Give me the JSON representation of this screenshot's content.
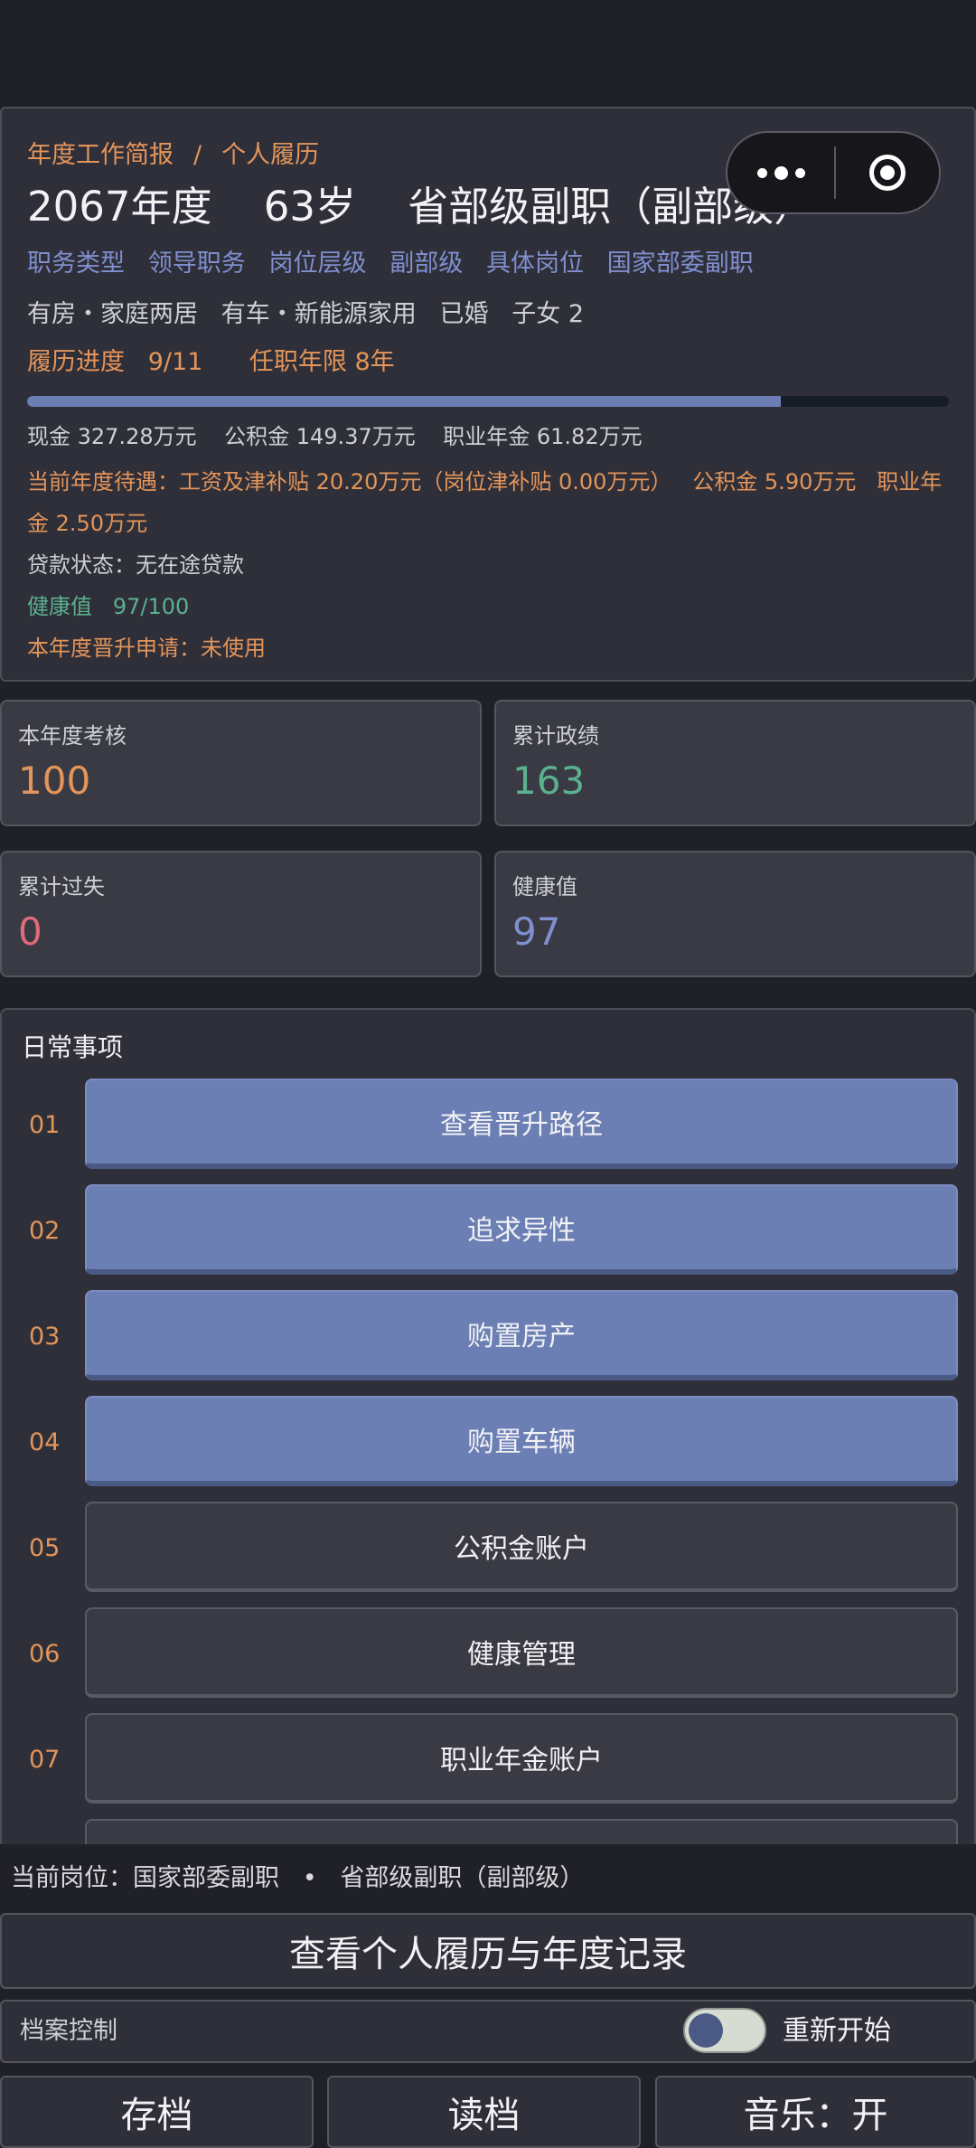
{
  "breadcrumb": {
    "left": "年度工作简报",
    "sep": "/",
    "right": "个人履历"
  },
  "headline": {
    "year": "2067年度",
    "age": "63岁",
    "rank": "省部级副职（副部级）"
  },
  "tags": {
    "type_label": "职务类型",
    "type_value": "领导职务",
    "level_label": "岗位层级",
    "level_value": "副部级",
    "post_label": "具体岗位",
    "post_value": "国家部委副职"
  },
  "assets": {
    "house": "有房・家庭两居",
    "car": "有车・新能源家用",
    "married": "已婚",
    "children": "子女 2"
  },
  "progress": {
    "label": "履历进度",
    "value": "9/11",
    "fraction": 0.8181,
    "tenure": "任职年限 8年"
  },
  "money": {
    "cash": "现金 327.28万元",
    "fund": "公积金 149.37万元",
    "pension": "职业年金 61.82万元"
  },
  "current_pay": "当前年度待遇：工资及津补贴 20.20万元（岗位津补贴 0.00万元）   公积金 5.90万元   职业年金 2.50万元",
  "loan": "贷款状态：无在途贷款",
  "health_line": {
    "label": "健康值",
    "value": "97/100"
  },
  "promotion": "本年度晋升申请：未使用",
  "stats": [
    {
      "label": "本年度考核",
      "value": "100",
      "color": "#e3955a"
    },
    {
      "label": "累计政绩",
      "value": "163",
      "color": "#5bb08e"
    },
    {
      "label": "累计过失",
      "value": "0",
      "color": "#e06b7a"
    },
    {
      "label": "健康值",
      "value": "97",
      "color": "#7f8fcf"
    }
  ],
  "daily": {
    "title": "日常事项",
    "items": [
      {
        "num": "01",
        "label": "查看晋升路径",
        "style": "blue"
      },
      {
        "num": "02",
        "label": "追求异性",
        "style": "blue"
      },
      {
        "num": "03",
        "label": "购置房产",
        "style": "blue"
      },
      {
        "num": "04",
        "label": "购置车辆",
        "style": "blue"
      },
      {
        "num": "05",
        "label": "公积金账户",
        "style": "dark"
      },
      {
        "num": "06",
        "label": "健康管理",
        "style": "dark"
      },
      {
        "num": "07",
        "label": "职业年金账户",
        "style": "dark"
      },
      {
        "num": "",
        "label": "",
        "style": "dark"
      }
    ]
  },
  "footer": {
    "current_post": "当前岗位：国家部委副职   •   省部级副职（副部级）",
    "resume_button": "查看个人履历与年度记录",
    "archive_label": "档案控制",
    "restart_label": "重新开始",
    "save": "存档",
    "load": "读档",
    "music": "音乐：开"
  },
  "colors": {
    "accent_orange": "#e3955a",
    "accent_blue": "#6b7fb4",
    "accent_green": "#5bb08e"
  }
}
